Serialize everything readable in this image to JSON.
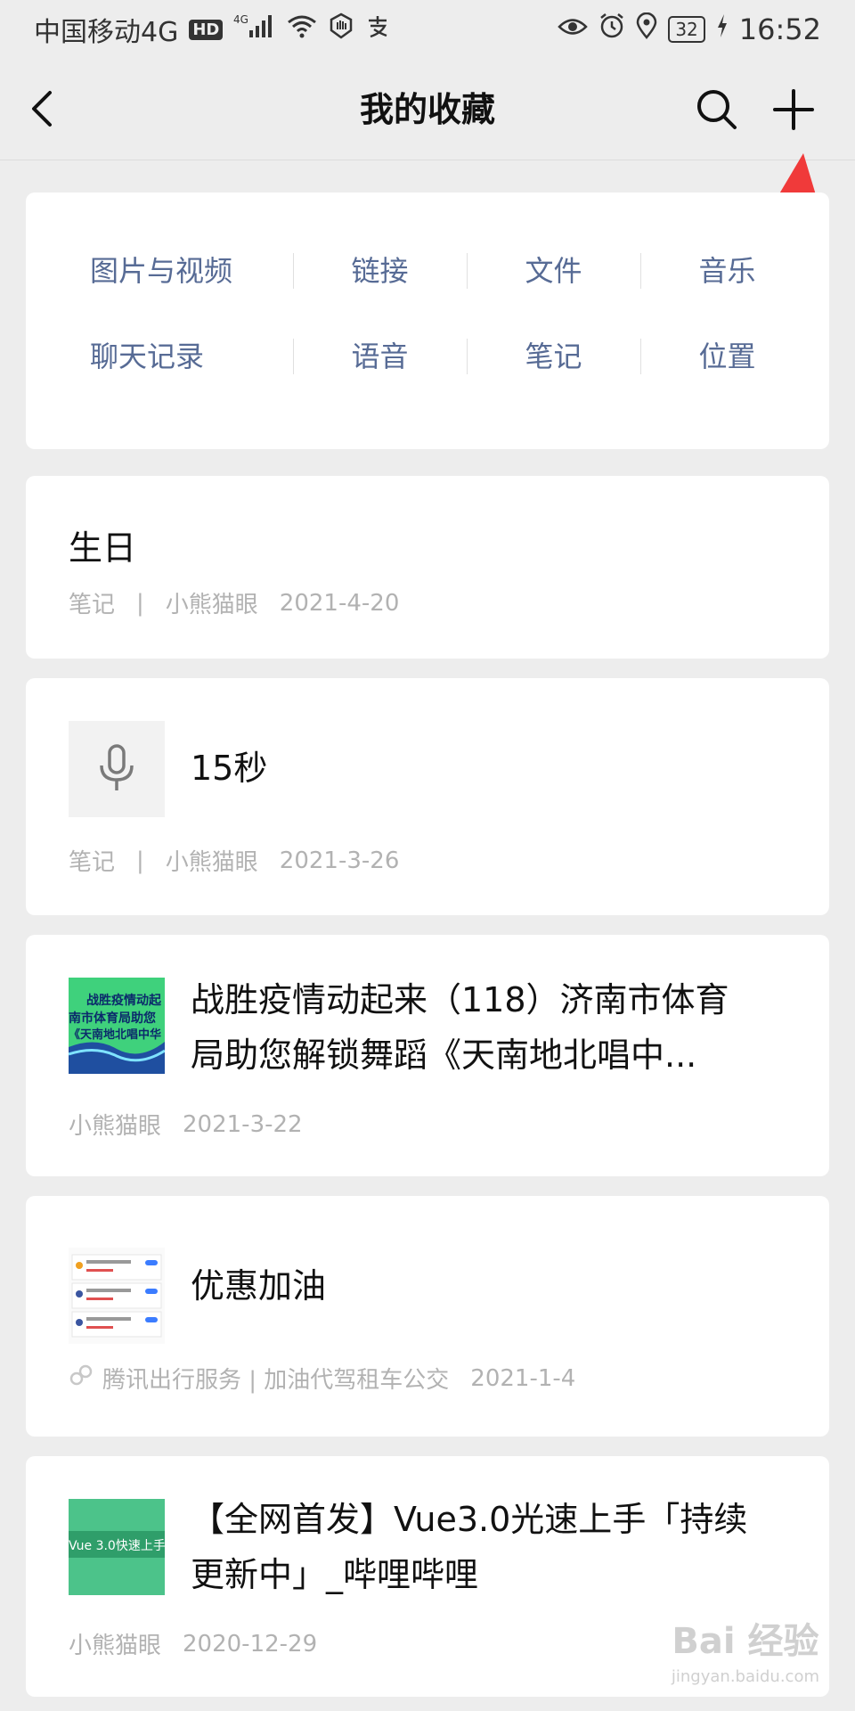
{
  "status_bar": {
    "carrier": "中国移动4G",
    "hd": "HD",
    "net": "4G",
    "battery": "32",
    "time": "16:52"
  },
  "nav": {
    "title": "我的收藏",
    "back_icon": "chevron-left-icon",
    "search_icon": "search-icon",
    "add_icon": "plus-icon"
  },
  "categories": {
    "row1": [
      "图片与视频",
      "链接",
      "文件",
      "音乐"
    ],
    "row2": [
      "聊天记录",
      "语音",
      "笔记",
      "位置"
    ]
  },
  "favorites": [
    {
      "title": "生日",
      "type": "笔记",
      "source": "小熊猫眼",
      "date": "2021-4-20"
    },
    {
      "title": "15秒",
      "type": "笔记",
      "source": "小熊猫眼",
      "date": "2021-3-26"
    },
    {
      "title_line1": "战胜疫情动起来（118）济南市体育",
      "title_line2": "局助您解锁舞蹈《天南地北唱中...",
      "source": "小熊猫眼",
      "date": "2021-3-22",
      "thumb_text": [
        "战胜疫情动起",
        "南市体育局助您",
        "《天南地北唱中华"
      ]
    },
    {
      "title": "优惠加油",
      "source": "腾讯出行服务 | 加油代驾租车公交",
      "date": "2021-1-4"
    },
    {
      "title_line1": "【全网首发】Vue3.0光速上手「持续",
      "title_line2": "更新中」_哔哩哔哩",
      "source": "小熊猫眼",
      "date": "2020-12-29",
      "thumb_text": "Vue 3.0快速上手"
    }
  ],
  "separator": "|",
  "watermark": {
    "main": "Bai 经验",
    "sub": "jingyan.baidu.com"
  },
  "colors": {
    "link_blue": "#576b95",
    "annotation_red": "#f03a3a",
    "meta_gray": "#b2b2b2"
  }
}
